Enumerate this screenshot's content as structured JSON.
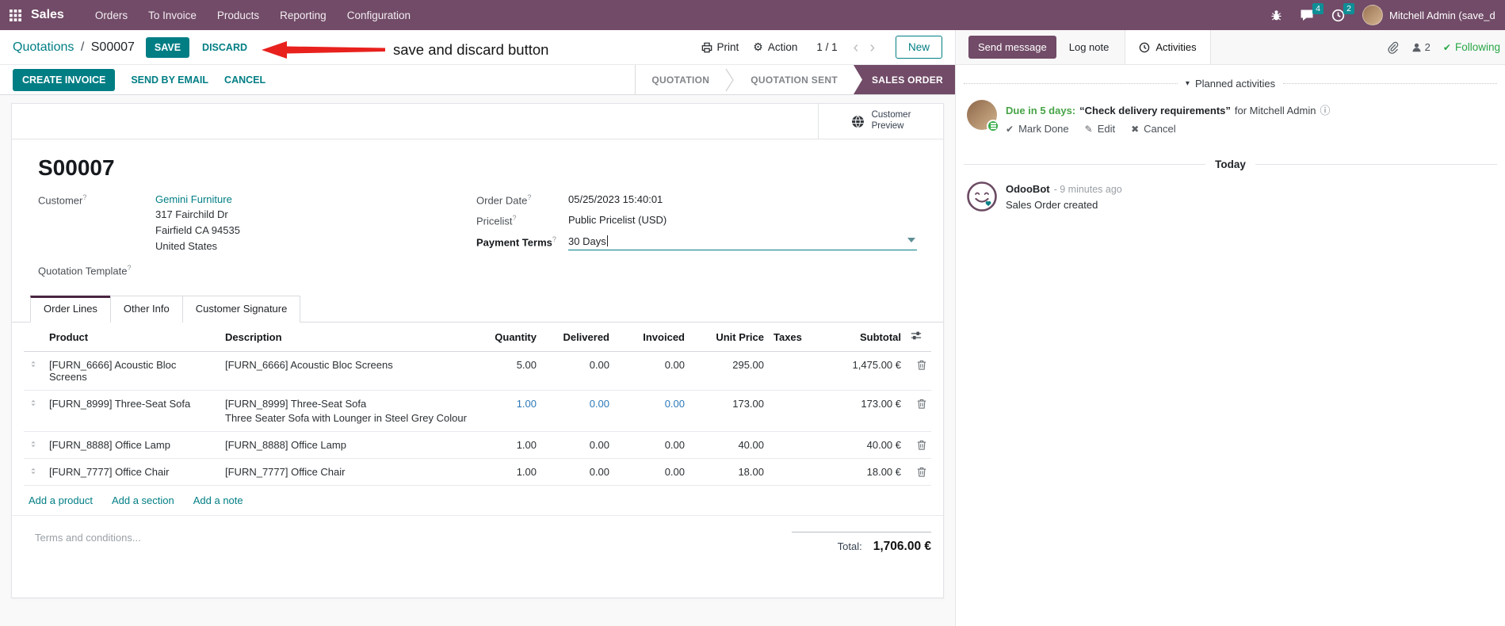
{
  "ui": {
    "help_marker": "?"
  },
  "icons": {
    "collapse_caret": "▾",
    "gear": "⚙",
    "check": "✔",
    "pencil": "✎",
    "cross": "✖",
    "info": "ⓘ",
    "chevron_left": "‹",
    "chevron_right": "›"
  },
  "colors": {
    "nav_brand": "#714B67",
    "primary_teal": "#017E84",
    "badge_teal": "#0F8E96",
    "stage_active": "#714B67",
    "annotation_red": "#E8211D",
    "edited_value_blue": "#2D79B8",
    "following_green": "#28A745",
    "due_green": "#47A447"
  },
  "nav": {
    "app_name": "Sales",
    "menus": {
      "orders": "Orders",
      "to_invoice": "To Invoice",
      "products": "Products",
      "reporting": "Reporting",
      "configuration": "Configuration"
    },
    "messages_badge": "4",
    "activities_badge": "2",
    "user_name": "Mitchell Admin (save_discar"
  },
  "control_panel": {
    "breadcrumb_parent": "Quotations",
    "breadcrumb_separator": "/",
    "breadcrumb_current": "S00007",
    "save": "SAVE",
    "discard": "DISCARD",
    "annotation_text": "save and discard button",
    "print": "Print",
    "action": "Action",
    "pager": "1 / 1",
    "new": "New"
  },
  "statusbar": {
    "create_invoice": "CREATE INVOICE",
    "send_by_email": "SEND BY EMAIL",
    "cancel": "CANCEL",
    "stage_quotation": "QUOTATION",
    "stage_quotation_sent": "QUOTATION SENT",
    "stage_sales_order": "SALES ORDER"
  },
  "sheet": {
    "customer_preview_line1": "Customer",
    "customer_preview_line2": "Preview",
    "title": "S00007",
    "customer_label": "Customer",
    "customer_name": "Gemini Furniture",
    "address_line1": "317 Fairchild Dr",
    "address_line2": "Fairfield CA 94535",
    "address_line3": "United States",
    "quotation_template_label": "Quotation Template",
    "order_date_label": "Order Date",
    "order_date_value": "05/25/2023 15:40:01",
    "pricelist_label": "Pricelist",
    "pricelist_value": "Public Pricelist (USD)",
    "payment_terms_label": "Payment Terms",
    "payment_terms_value": "30 Days",
    "tabs": {
      "order_lines": "Order Lines",
      "other_info": "Other Info",
      "customer_signature": "Customer Signature"
    },
    "table": {
      "headers": {
        "product": "Product",
        "description": "Description",
        "quantity": "Quantity",
        "delivered": "Delivered",
        "invoiced": "Invoiced",
        "unit_price": "Unit Price",
        "taxes": "Taxes",
        "subtotal": "Subtotal"
      },
      "rows": [
        {
          "product": "[FURN_6666] Acoustic Bloc Screens",
          "description": "[FURN_6666] Acoustic Bloc Screens",
          "description2": "",
          "quantity": "5.00",
          "delivered": "0.00",
          "invoiced": "0.00",
          "unit_price": "295.00",
          "taxes": "",
          "subtotal": "1,475.00 €"
        },
        {
          "product": "[FURN_8999] Three-Seat Sofa",
          "description": "[FURN_8999] Three-Seat Sofa",
          "description2": "Three Seater Sofa with Lounger in Steel Grey Colour",
          "quantity": "1.00",
          "delivered": "0.00",
          "invoiced": "0.00",
          "unit_price": "173.00",
          "taxes": "",
          "subtotal": "173.00 €"
        },
        {
          "product": "[FURN_8888] Office Lamp",
          "description": "[FURN_8888] Office Lamp",
          "description2": "",
          "quantity": "1.00",
          "delivered": "0.00",
          "invoiced": "0.00",
          "unit_price": "40.00",
          "taxes": "",
          "subtotal": "40.00 €"
        },
        {
          "product": "[FURN_7777] Office Chair",
          "description": "[FURN_7777] Office Chair",
          "description2": "",
          "quantity": "1.00",
          "delivered": "0.00",
          "invoiced": "0.00",
          "unit_price": "18.00",
          "taxes": "",
          "subtotal": "18.00 €"
        }
      ],
      "add_product": "Add a product",
      "add_section": "Add a section",
      "add_note": "Add a note"
    },
    "terms_placeholder": "Terms and conditions...",
    "total_label": "Total:",
    "total_value": "1,706.00 €"
  },
  "chatter": {
    "send_message": "Send message",
    "log_note": "Log note",
    "activities_tab": "Activities",
    "followers_count": "2",
    "following": "Following",
    "planned_activities_header": "Planned activities",
    "activity": {
      "due": "Due in 5 days:",
      "summary": "“Check delivery requirements”",
      "assignee": "for Mitchell Admin",
      "mark_done": "Mark Done",
      "edit": "Edit",
      "cancel": "Cancel"
    },
    "today_divider": "Today",
    "message": {
      "author": "OdooBot",
      "timestamp": "- 9 minutes ago",
      "body": "Sales Order created"
    }
  }
}
